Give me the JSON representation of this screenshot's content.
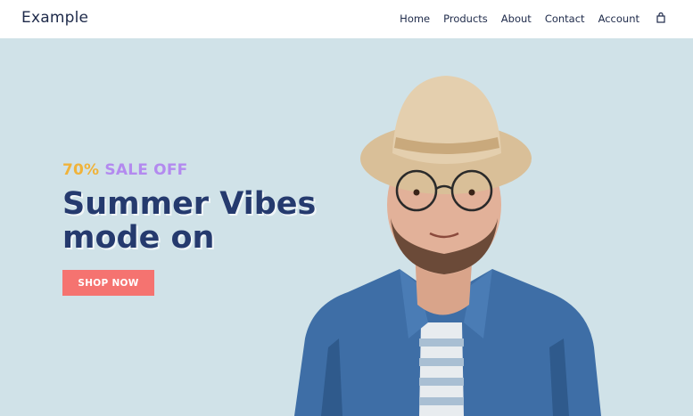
{
  "header": {
    "brand": "Example",
    "nav": [
      {
        "label": "Home"
      },
      {
        "label": "Products"
      },
      {
        "label": "About"
      },
      {
        "label": "Contact"
      },
      {
        "label": "Account"
      }
    ],
    "cart_icon": "shopping-bag-icon"
  },
  "hero": {
    "promo_percent": "70%",
    "promo_text": "SALE OFF",
    "headline_line1": "Summer Vibes",
    "headline_line2": "mode on",
    "cta_label": "SHOP NOW",
    "image": "man-in-straw-hat-and-denim-shirt"
  },
  "colors": {
    "background": "#d0e2e8",
    "navy": "#253a6e",
    "promo_yellow": "#f0b33a",
    "promo_purple": "#b38aef",
    "cta": "#f57370"
  }
}
